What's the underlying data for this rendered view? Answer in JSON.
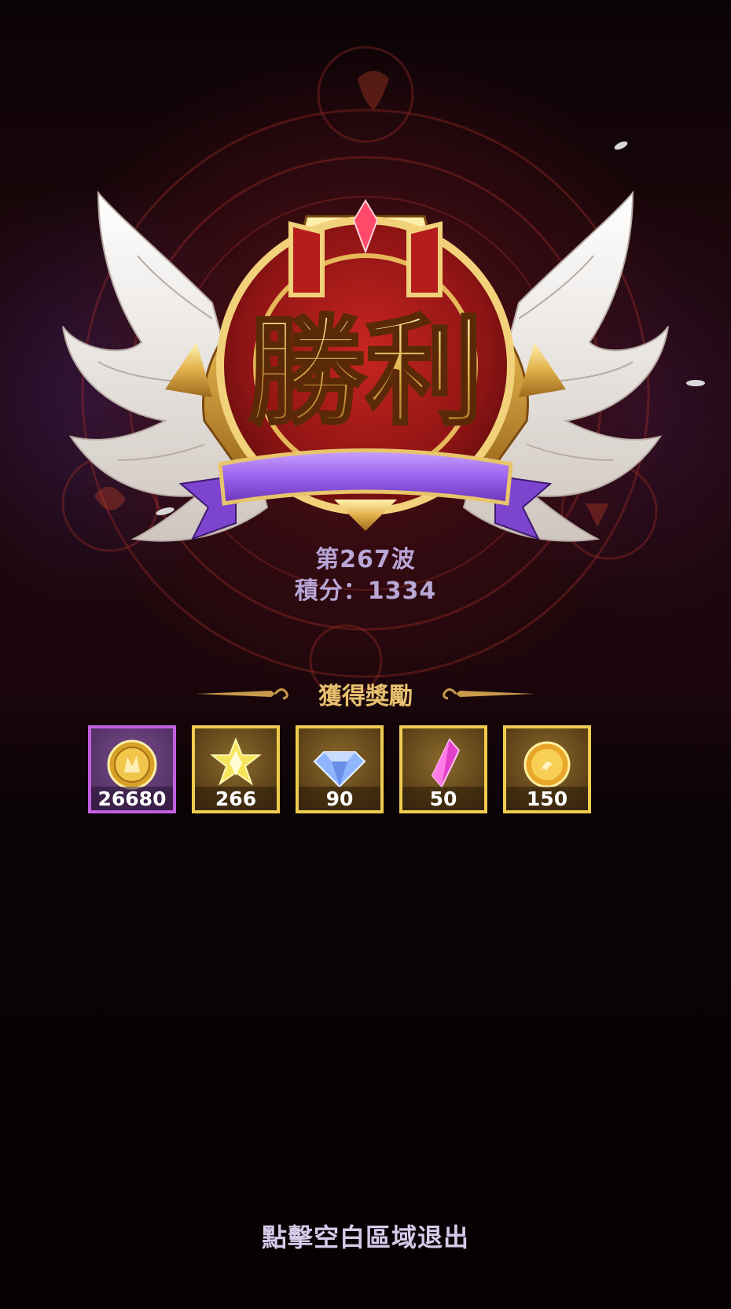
{
  "result": {
    "banner_text": "勝利",
    "wave_label": "第267波",
    "score_label": "積分：1334"
  },
  "rewards": {
    "title": "獲得獎勵",
    "items": [
      {
        "icon": "gold-coin-icon",
        "quantity": "26680",
        "frame": "purple"
      },
      {
        "icon": "yellow-star-crystal-icon",
        "quantity": "266",
        "frame": "gold"
      },
      {
        "icon": "blue-diamond-icon",
        "quantity": "90",
        "frame": "gold"
      },
      {
        "icon": "pink-crystal-icon",
        "quantity": "50",
        "frame": "gold"
      },
      {
        "icon": "gold-orb-icon",
        "quantity": "150",
        "frame": "gold"
      }
    ]
  },
  "footer": {
    "exit_hint": "點擊空白區域退出"
  },
  "colors": {
    "gold_frame": "#f0cc4e",
    "purple_frame": "#c25fe0",
    "wave_text": "#b8a6d6",
    "reward_title": "#e8c170",
    "background": "#070204"
  }
}
